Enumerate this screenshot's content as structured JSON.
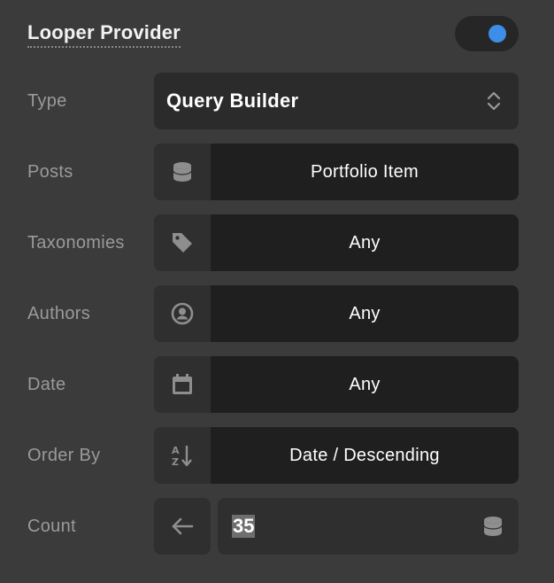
{
  "header": {
    "title": "Looper Provider",
    "toggle_state": "on",
    "toggle_color": "#3d8ee6"
  },
  "rows": {
    "type": {
      "label": "Type",
      "value": "Query Builder",
      "icon": "chevron-up-down-icon"
    },
    "posts": {
      "label": "Posts",
      "value": "Portfolio Item",
      "icon": "database-icon"
    },
    "taxonomies": {
      "label": "Taxonomies",
      "value": "Any",
      "icon": "tag-icon"
    },
    "authors": {
      "label": "Authors",
      "value": "Any",
      "icon": "user-circle-icon"
    },
    "date": {
      "label": "Date",
      "value": "Any",
      "icon": "calendar-icon"
    },
    "order_by": {
      "label": "Order By",
      "value": "Date / Descending",
      "icon": "sort-az-icon"
    },
    "count": {
      "label": "Count",
      "value": "35",
      "left_icon": "arrow-left-icon",
      "right_icon": "database-icon"
    }
  }
}
